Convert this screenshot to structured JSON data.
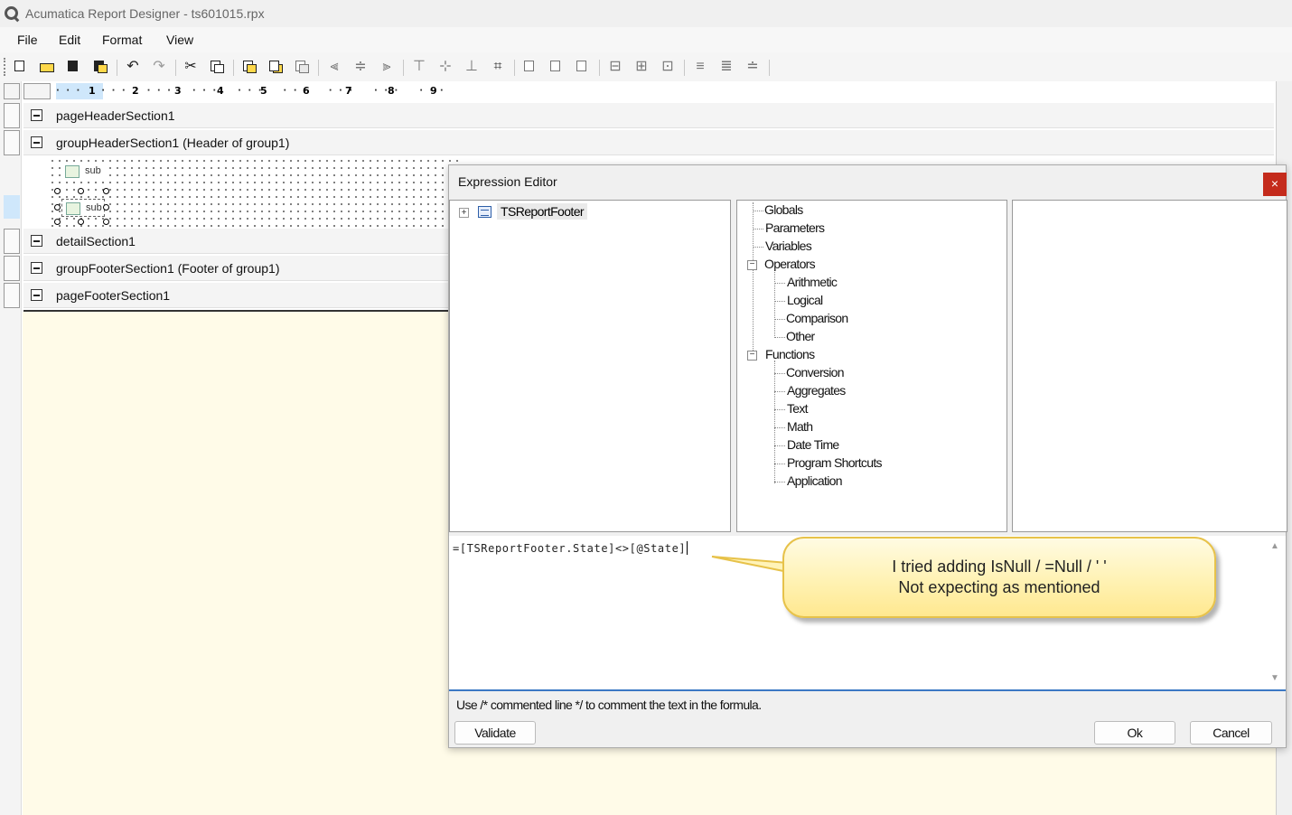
{
  "window": {
    "title": "Acumatica Report Designer - ts601015.rpx"
  },
  "menu": [
    "File",
    "Edit",
    "Format",
    "View"
  ],
  "ruler": {
    "numbers": [
      "1",
      "2",
      "3",
      "4",
      "5",
      "6",
      "7",
      "8",
      "9"
    ]
  },
  "sections": [
    "pageHeaderSection1",
    "groupHeaderSection1 (Header of group1)",
    "detailSection1",
    "groupFooterSection1 (Footer of group1)",
    "pageFooterSection1"
  ],
  "sub_items": [
    "sub",
    "sub"
  ],
  "dialog": {
    "title": "Expression Editor",
    "close": "×",
    "fields_tree": {
      "root": "TSReportFooter"
    },
    "functions_tree": {
      "globals": "Globals",
      "parameters": "Parameters",
      "variables": "Variables",
      "operators": "Operators",
      "operator_items": [
        "Arithmetic",
        "Logical",
        "Comparison",
        "Other"
      ],
      "functions": "Functions",
      "function_items": [
        "Conversion",
        "Aggregates",
        "Text",
        "Math",
        "Date Time",
        "Program Shortcuts",
        "Application"
      ]
    },
    "expression": "=[TSReportFooter.State]<>[@State]",
    "hint": "Use /* commented line */ to comment the text in the formula.",
    "validate_label": "Validate",
    "ok_label": "Ok",
    "cancel_label": "Cancel"
  },
  "callout": {
    "line1": "I tried adding IsNull / =Null / ' '",
    "line2": "Not expecting as mentioned"
  },
  "colors": {
    "close_button": "#c42b1c",
    "canvas": "#fffbe8",
    "callout_border": "#e7c24a",
    "editor_border": "#3b78c4"
  }
}
